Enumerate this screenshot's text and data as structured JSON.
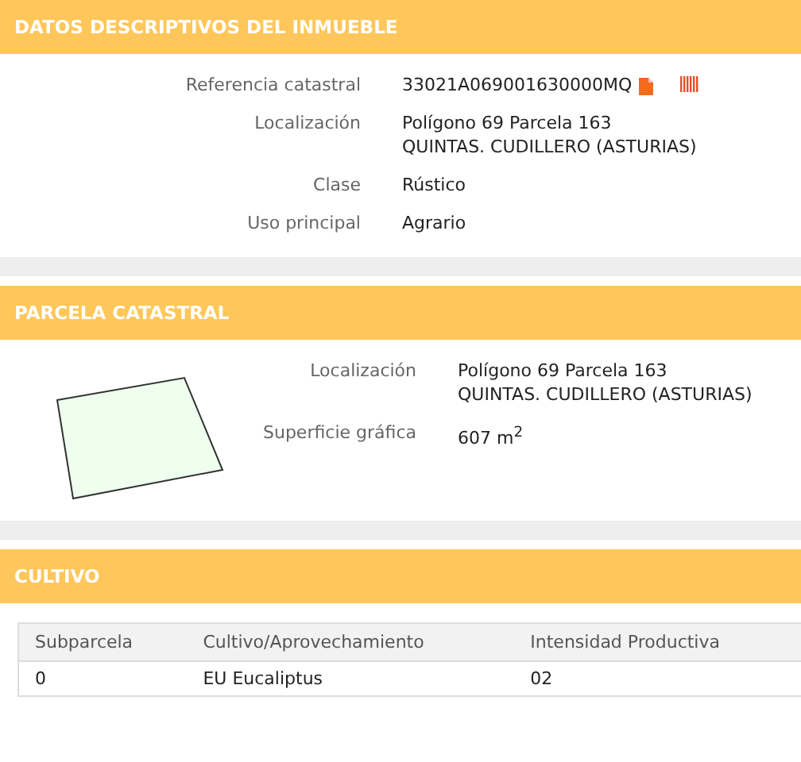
{
  "sections": [
    {
      "kind": "fields",
      "title": "DATOS DESCRIPTIVOS DEL INMUEBLE",
      "fields": [
        {
          "label": "Referencia catastral",
          "lines": [
            "33021A069001630000MQ"
          ],
          "icons": true
        },
        {
          "label": "Localización",
          "lines": [
            "Polígono 69 Parcela 163",
            "QUINTAS. CUDILLERO (ASTURIAS)"
          ]
        },
        {
          "label": "Clase",
          "lines": [
            "Rústico"
          ]
        },
        {
          "label": "Uso principal",
          "lines": [
            "Agrario"
          ]
        }
      ]
    },
    {
      "kind": "parcel",
      "title": "PARCELA CATASTRAL",
      "fields": [
        {
          "label": "Localización",
          "lines": [
            "Polígono 69 Parcela 163",
            "QUINTAS. CUDILLERO (ASTURIAS)"
          ]
        },
        {
          "label": "Superficie gráfica",
          "lines": [
            "607 m$^{2}$"
          ]
        }
      ]
    },
    {
      "kind": "table",
      "title": "CULTIVO",
      "columns": [
        "Subparcela",
        "Cultivo/Aprovechamiento",
        "Intensidad Productiva"
      ],
      "rows": [
        [
          "0",
          "EU Eucaliptus",
          "02"
        ]
      ]
    }
  ]
}
